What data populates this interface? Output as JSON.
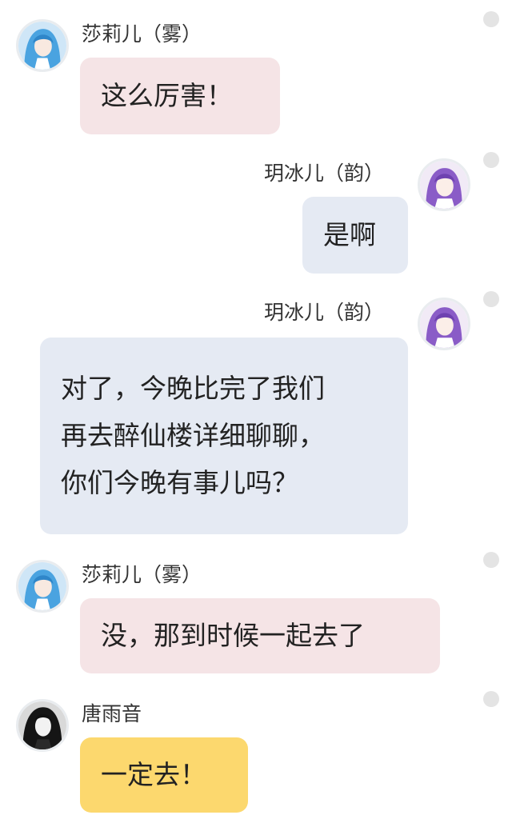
{
  "colors": {
    "bubble_pink": "#f5e4e6",
    "bubble_blue": "#e5eaf3",
    "bubble_yellow": "#fcd86e",
    "status_dot": "#e4e4e4"
  },
  "messages": [
    {
      "sender": "莎莉儿（雾）",
      "side": "left",
      "avatar": "blue-haired-girl-avatar",
      "bubble_color": "pink",
      "lines": [
        "这么厉害！"
      ]
    },
    {
      "sender": "玥冰儿（韵）",
      "side": "right",
      "avatar": "purple-haired-girl-avatar",
      "bubble_color": "blue",
      "lines": [
        "是啊"
      ]
    },
    {
      "sender": "玥冰儿（韵）",
      "side": "right",
      "avatar": "purple-haired-girl-avatar",
      "bubble_color": "blue",
      "lines": [
        "对了，今晚比完了我们",
        "再去醉仙楼详细聊聊，",
        "你们今晚有事儿吗？"
      ]
    },
    {
      "sender": "莎莉儿（雾）",
      "side": "left",
      "avatar": "blue-haired-girl-avatar",
      "bubble_color": "pink",
      "lines": [
        "没，那到时候一起去了"
      ]
    },
    {
      "sender": "唐雨音",
      "side": "left",
      "avatar": "dark-haired-girl-avatar",
      "bubble_color": "yellow",
      "lines": [
        "一定去！"
      ]
    }
  ]
}
